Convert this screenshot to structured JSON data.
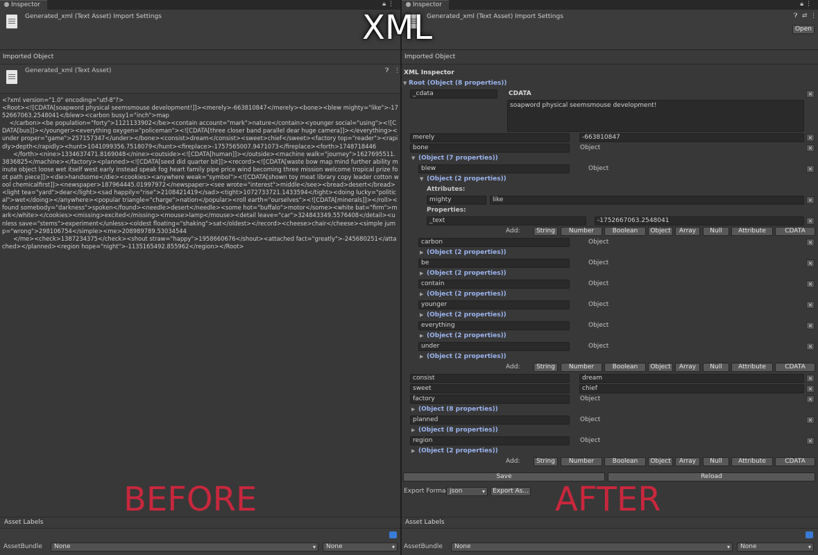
{
  "overlay": {
    "top_title": "XML",
    "left_caption": "BEFORE",
    "right_caption": "AFTER",
    "caption_color": "#c8273d"
  },
  "tab_label": "Inspector",
  "header": {
    "title": "Generated_xml (Text Asset) Import Settings",
    "open_button": "Open"
  },
  "imported_object_label": "Imported Object",
  "asset_name": "Generated_xml (Text Asset)",
  "xml_text": "<?xml version=\"1.0\" encoding=\"utf-8\"?>\n<Root><![CDATA[soapword physical seemsmouse development!]]><merely>-663810847</merely><bone><blew mighty=\"like\">-1752667063.2548041</blew><carbon busy1=\"inch\">map\n    </carbon><be population=\"forty\">1121133902</be><contain account=\"mark\">nature</contain><younger social=\"using\"><![CDATA[bus]]></younger><everything oxygen=\"policeman\"><![CDATA[three closer band parallel dear huge camera]]></everything><under proper=\"game\">257157347</under></bone><consist>dream</consist><sweet>chief</sweet><factory top=\"reader\"><rapidly>depth</rapidly><hunt>1041099356.7518079</hunt><fireplace>-1757565007.9471073</fireplace><forth>1748718446\n      </forth><nine>1334637471.8169048</nine><outside><![CDATA[human]]></outside><machine walk=\"journey\">1627695511.3836825</machine></factory><planned><![CDATA[seed did quarter bit]]><record><![CDATA[waste bow map mind further ability minute object loose wet itself west early instead speak fog heart family pipe price wind becoming three mission welcome tropical prize foot path piece]]><die>handsome</die><cookies><anywhere weak=\"symbol\"><![CDATA[shown toy meat library copy leader cotton wool chemicalfirst]]><newspaper>187964445.01997972</newspaper><see wrote=\"interest\">middle</see><bread>desert</bread><light tea=\"yard\">dear</light><sad happily=\"rise\">2108421419</sad><tight>1072733721.1433594</tight><doing lucky=\"political\">wet</doing></anywhere><popular triangle=\"charge\">nation</popular><roll earth=\"ourselves\"><![CDATA[minerals]]></roll><found somebody=\"darkness\">spoken</found><needle>desert</needle><some hot=\"buffalo\">motor</some><white bat=\"firm\">mark</white></cookies><missing>excited</missing><mouse>lamp</mouse><detail leave=\"car\">324843349.5576408</detail><unless save=\"stems\">experiment</unless><oldest floating=\"shaking\">sat</oldest></record><cheese>chair</cheese><simple jump=\"wrong\">298106754</simple><me>208989789.53034544\n      </me><check>1387234375</check><shout straw=\"happy\">1958660676</shout><attached fact=\"greatly\">-245680251</attached></planned><region hope=\"night\">-1135165492.855962</region></Root>",
  "xml_inspector": {
    "title": "XML Inspector",
    "root": "Root (Object (8 properties))",
    "cdata_key": "_cdata",
    "cdata_label": "CDATA",
    "cdata_value": "soapword physical seemsmouse development!",
    "rows": [
      {
        "key": "merely",
        "value": "-663810847"
      },
      {
        "key": "bone",
        "value": "Object"
      }
    ],
    "bone_obj": "(Object (7 properties))",
    "blew": {
      "key": "blew",
      "value": "Object",
      "obj": "(Object (2 properties))"
    },
    "attributes_label": "Attributes:",
    "attr_key": "mighty",
    "attr_val": "like",
    "properties_label": "Properties:",
    "text_key": "_text",
    "text_val": "-1752667063.2548041",
    "children": [
      {
        "key": "carbon",
        "value": "Object",
        "obj": "(Object (2 properties))"
      },
      {
        "key": "be",
        "value": "Object",
        "obj": "(Object (2 properties))"
      },
      {
        "key": "contain",
        "value": "Object",
        "obj": "(Object (2 properties))"
      },
      {
        "key": "younger",
        "value": "Object",
        "obj": "(Object (2 properties))"
      },
      {
        "key": "everything",
        "value": "Object",
        "obj": "(Object (2 properties))"
      },
      {
        "key": "under",
        "value": "Object",
        "obj": "(Object (2 properties))"
      }
    ],
    "consist": {
      "key": "consist",
      "value": "dream"
    },
    "sweet": {
      "key": "sweet",
      "value": "chief"
    },
    "factory": {
      "key": "factory",
      "value": "Object",
      "obj": "(Object (8 properties))"
    },
    "planned": {
      "key": "planned",
      "value": "Object",
      "obj": "(Object (8 properties))"
    },
    "region": {
      "key": "region",
      "value": "Object",
      "obj": "(Object (2 properties))"
    },
    "add_label": "Add:",
    "add_buttons": [
      "String",
      "Number",
      "Boolean",
      "Object",
      "Array",
      "Null",
      "Attribute",
      "CDATA"
    ],
    "remove_glyph": "×",
    "save": "Save",
    "reload": "Reload",
    "export_label": "Export Forma",
    "export_format": "json",
    "export_as": "Export As..."
  },
  "asset_labels": "Asset Labels",
  "assetbundle_label": "AssetBundle",
  "assetbundle_value": "None",
  "assetbundle_variant": "None"
}
